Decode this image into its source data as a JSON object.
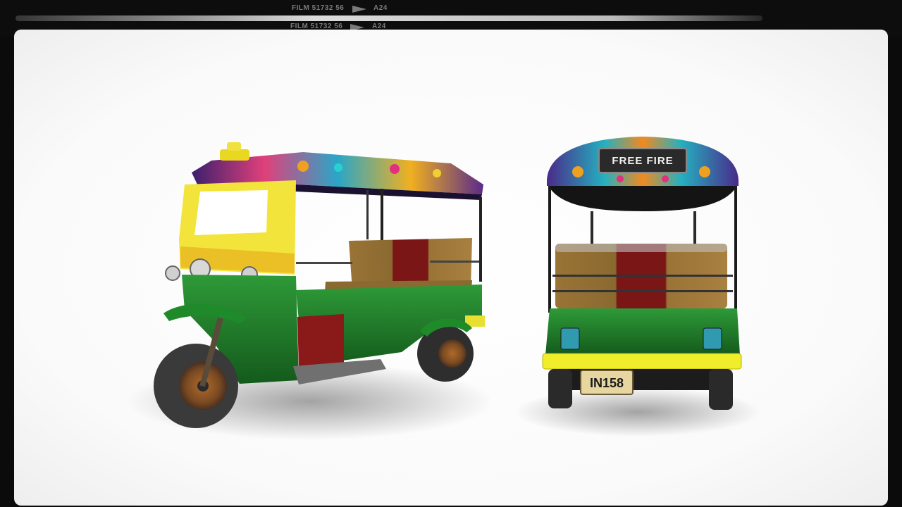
{
  "film": {
    "line1": {
      "code": "FILM 51732 56",
      "frame": "A24"
    },
    "line2": {
      "code": "FILM 51732 56",
      "frame": "A24"
    }
  },
  "rickshaw_rear": {
    "roof_badge": "FREE FIRE",
    "license_plate": "IN158"
  },
  "colors": {
    "body_green": "#1f7a2a",
    "cab_yellow": "#f2e43a",
    "seat_red": "#8a1a1a",
    "seat_tan": "#a27a3e",
    "roof_purple": "#4a2a7a",
    "bumper_yellow": "#f0ee2a"
  }
}
